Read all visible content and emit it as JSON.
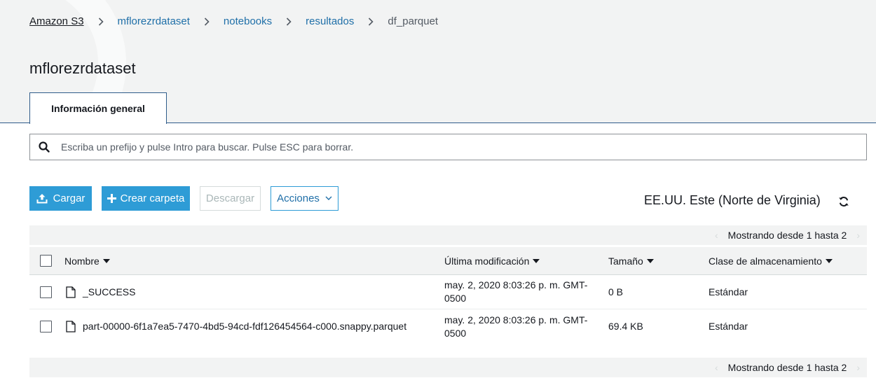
{
  "breadcrumb": {
    "items": [
      "Amazon S3",
      "mflorezrdataset",
      "notebooks",
      "resultados",
      "df_parquet"
    ]
  },
  "page_title": "mflorezrdataset",
  "tabs": [
    {
      "label": "Información general"
    }
  ],
  "search": {
    "placeholder": "Escriba un prefijo y pulse Intro para buscar. Pulse ESC para borrar.",
    "value": ""
  },
  "toolbar": {
    "upload_label": "Cargar",
    "create_folder_label": "Crear carpeta",
    "download_label": "Descargar",
    "actions_label": "Acciones"
  },
  "region": "EE.UU. Este (Norte de Virginia)",
  "pagination": {
    "text": "Mostrando desde 1 hasta 2"
  },
  "table": {
    "columns": [
      "Nombre",
      "Última modificación",
      "Tamaño",
      "Clase de almacenamiento"
    ],
    "rows": [
      {
        "name": "_SUCCESS",
        "modified_line1": "may. 2, 2020 8:03:26 p. m. GMT-",
        "modified_line2": "0500",
        "size": "0 B",
        "storage": "Estándar"
      },
      {
        "name": "part-00000-6f1a7ea5-7470-4bd5-94cd-fdf126454564-c000.snappy.parquet",
        "modified_line1": "may. 2, 2020 8:03:26 p. m. GMT-",
        "modified_line2": "0500",
        "size": "69.4 KB",
        "storage": "Estándar"
      }
    ]
  },
  "colors": {
    "accent": "#2e9cd6",
    "link": "#1f6fa8",
    "header_bg": "#f2f3f3"
  },
  "icons": [
    "search-icon",
    "upload-icon",
    "plus-icon",
    "chevron-down-icon",
    "refresh-icon",
    "file-icon",
    "chevron-right-icon"
  ]
}
